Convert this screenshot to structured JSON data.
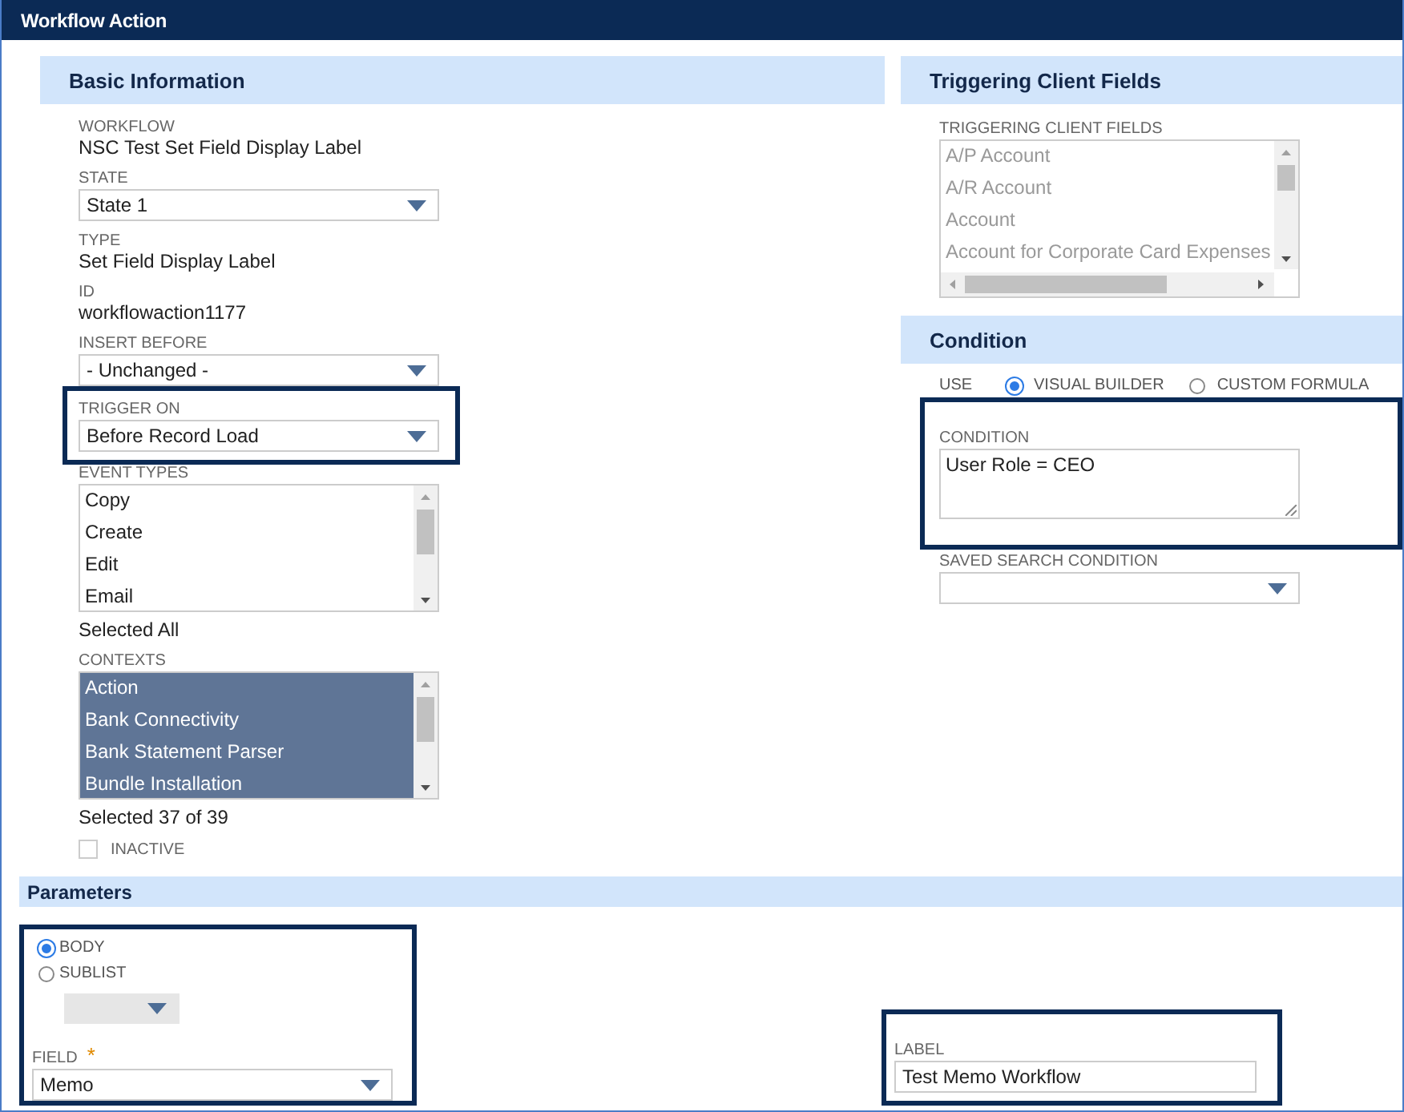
{
  "window": {
    "title": "Workflow Action"
  },
  "basic_information": {
    "title": "Basic Information",
    "fields": [
      {
        "kind": "text",
        "label": "WORKFLOW",
        "value": "NSC Test Set Field Display Label"
      },
      {
        "kind": "select",
        "label": "STATE",
        "value": "State 1"
      },
      {
        "kind": "text",
        "label": "TYPE",
        "value": "Set Field Display Label"
      },
      {
        "kind": "text",
        "label": "ID",
        "value": "workflowaction1177"
      },
      {
        "kind": "select",
        "label": "INSERT BEFORE",
        "value": "- Unchanged -"
      },
      {
        "kind": "select",
        "label": "TRIGGER ON",
        "value": "Before Record Load",
        "highlighted": true
      },
      {
        "kind": "listbox",
        "label": "EVENT TYPES",
        "note": "Selected All",
        "items": [
          {
            "label": "Copy",
            "selected": false
          },
          {
            "label": "Create",
            "selected": false
          },
          {
            "label": "Edit",
            "selected": false
          },
          {
            "label": "Email",
            "selected": false
          }
        ]
      },
      {
        "kind": "listbox",
        "label": "CONTEXTS",
        "note": "Selected 37 of 39",
        "items": [
          {
            "label": "Action",
            "selected": true
          },
          {
            "label": "Bank Connectivity",
            "selected": true
          },
          {
            "label": "Bank Statement Parser",
            "selected": true
          },
          {
            "label": "Bundle Installation",
            "selected": true
          }
        ]
      },
      {
        "kind": "checkbox",
        "label": "INACTIVE",
        "checked": false
      }
    ]
  },
  "triggering_client_fields": {
    "title": "Triggering Client Fields",
    "label": "TRIGGERING CLIENT FIELDS",
    "disabled": true,
    "items": [
      "A/P Account",
      "A/R Account",
      "Account",
      "Account for Corporate Card Expenses"
    ]
  },
  "condition": {
    "title": "Condition",
    "use_label": "USE",
    "options": [
      {
        "label": "VISUAL BUILDER",
        "selected": true
      },
      {
        "label": "CUSTOM FORMULA",
        "selected": false
      }
    ],
    "condition_field": {
      "label": "CONDITION",
      "value": "User Role = CEO",
      "highlighted": true
    },
    "saved_search": {
      "label": "SAVED SEARCH CONDITION"
    }
  },
  "parameters": {
    "title": "Parameters",
    "highlighted": true,
    "scope_options": [
      {
        "label": "BODY",
        "selected": true
      },
      {
        "label": "SUBLIST",
        "selected": false
      }
    ],
    "sublist_select": {
      "disabled": true
    },
    "field": {
      "label": "FIELD",
      "required_mark": "*",
      "value": "Memo"
    },
    "label_field": {
      "label": "LABEL",
      "value": "Test Memo Workflow",
      "highlighted": true
    }
  }
}
